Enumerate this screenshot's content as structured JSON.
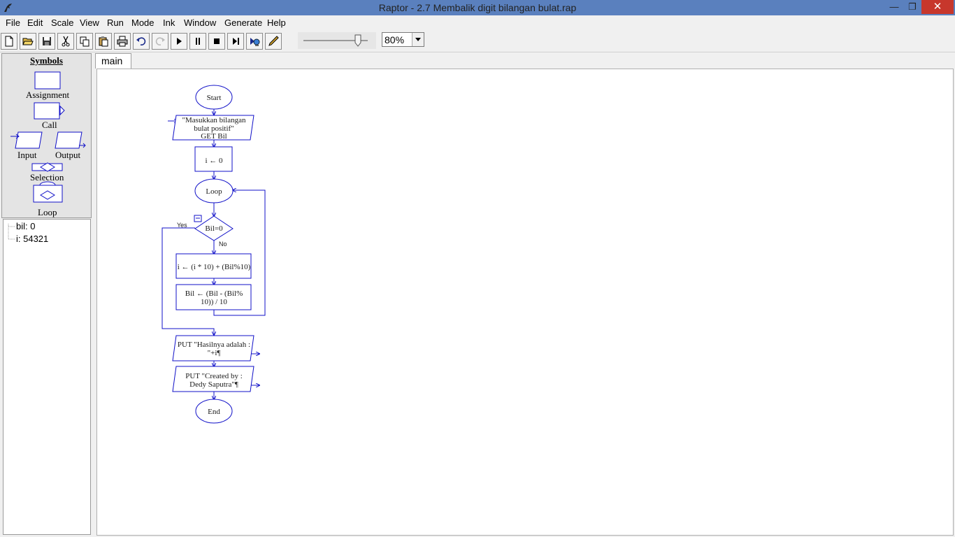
{
  "window": {
    "title": "Raptor - 2.7 Membalik digit bilangan bulat.rap",
    "min_glyph": "—",
    "max_glyph": "❐",
    "close_glyph": "✕"
  },
  "menu": [
    "File",
    "Edit",
    "Scale",
    "View",
    "Run",
    "Mode",
    "Ink",
    "Window",
    "Generate",
    "Help"
  ],
  "toolbar": {
    "icons": [
      "new-file-icon",
      "open-folder-icon",
      "save-icon",
      "cut-icon",
      "copy-icon",
      "paste-icon",
      "print-icon",
      "undo-icon",
      "redo-icon",
      "play-icon",
      "pause-icon",
      "stop-icon",
      "step-icon",
      "server-icon",
      "pen-icon"
    ],
    "speed_fraction": 0.85,
    "zoom": "80%"
  },
  "palette": {
    "title": "Symbols",
    "assignment": "Assignment",
    "call": "Call",
    "input": "Input",
    "output": "Output",
    "selection": "Selection",
    "loop": "Loop"
  },
  "variables": [
    "bil: 0",
    "i: 54321"
  ],
  "tab": "main",
  "flowchart": {
    "start": "Start",
    "input_prompt_1": "\"Masukkan bilangan",
    "input_prompt_2": "bulat positif\"",
    "input_get": "GET Bil",
    "assign_init": "i ← 0",
    "loop": "Loop",
    "condition": "Bil=0",
    "yes": "Yes",
    "no": "No",
    "assign_i": "i ← (i * 10) + (Bil%10)",
    "assign_bil_1": "Bil ← (Bil - (Bil%",
    "assign_bil_2": "10)) / 10",
    "output1_1": "PUT \"Hasilnya adalah :",
    "output1_2": "\"+i¶",
    "output2_1": "PUT \"Created by :",
    "output2_2": "Dedy Saputra\"¶",
    "end": "End"
  },
  "colors": {
    "titlebar": "#5a80be",
    "flow_stroke": "#1010c8",
    "close_button": "#c7372c"
  }
}
